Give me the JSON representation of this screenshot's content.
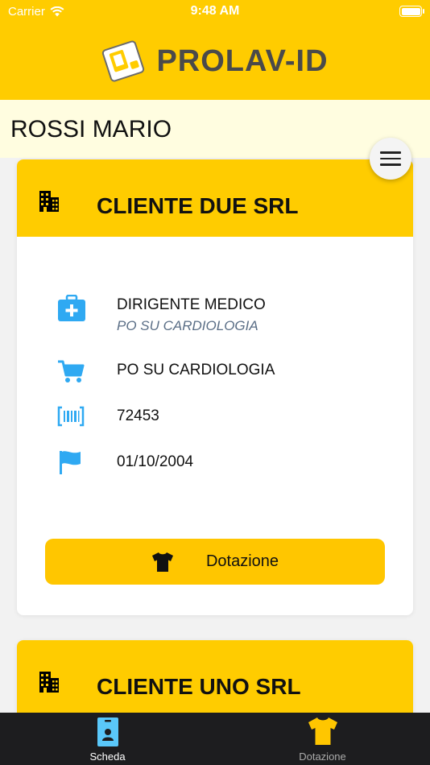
{
  "status_bar": {
    "carrier": "Carrier",
    "time": "9:48 AM"
  },
  "header": {
    "app_title": "PROLAV-ID",
    "brand_color": "#ffcc00"
  },
  "user": {
    "name": "ROSSI MARIO"
  },
  "menu": {
    "icon": "hamburger-menu-icon"
  },
  "cards": [
    {
      "company": "CLIENTE DUE SRL",
      "header_icon": "building-icon",
      "role": "DIRIGENTE MEDICO",
      "role_department": "PO SU CARDIOLOGIA",
      "department": "PO SU CARDIOLOGIA",
      "badge_number": "72453",
      "start_date": "01/10/2004",
      "button_label": "Dotazione"
    },
    {
      "company": "CLIENTE UNO SRL",
      "header_icon": "building-icon"
    }
  ],
  "icons": {
    "role": "medical-kit-icon",
    "department": "shopping-cart-icon",
    "badge": "barcode-icon",
    "date": "flag-icon",
    "button": "tshirt-icon"
  },
  "tabs": [
    {
      "label": "Scheda",
      "icon": "id-badge-icon",
      "active": true
    },
    {
      "label": "Dotazione",
      "icon": "tshirt-icon",
      "active": false
    }
  ],
  "colors": {
    "accent_blue": "#2fa9f2",
    "tab_active_icon": "#5ac8fa",
    "tab_inactive_icon": "#ffc600"
  }
}
